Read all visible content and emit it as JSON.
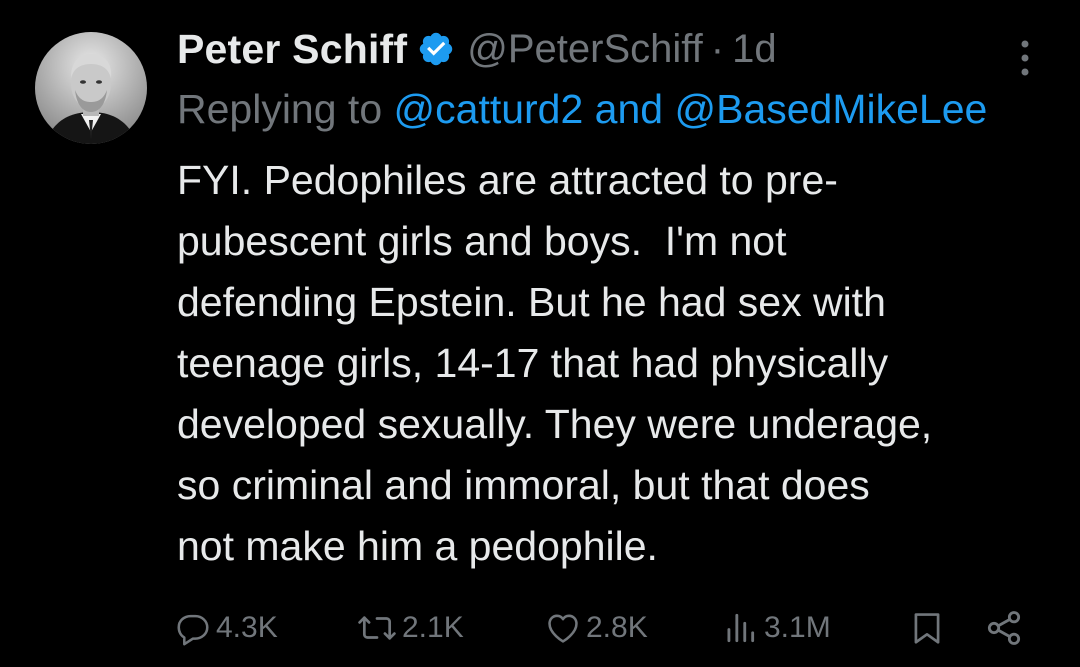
{
  "tweet": {
    "author_name": "Peter Schiff",
    "handle": "@PeterSchiff",
    "separator": "·",
    "time": "1d",
    "replying_prefix": "Replying to ",
    "reply_mention_1": "@catturd2",
    "reply_and": " and ",
    "reply_mention_2": "@BasedMikeLee",
    "text": "FYI. Pedophiles are attracted to pre-\npubescent girls and boys.  I'm not\ndefending Epstein. But he had sex with\nteenage girls, 14-17 that had physically\ndeveloped sexually. They were underage,\nso criminal and immoral, but that does\nnot make him a pedophile."
  },
  "actions": {
    "replies": "4.3K",
    "reposts": "2.1K",
    "likes": "2.8K",
    "views": "3.1M"
  },
  "icons": {
    "verified": "verified-badge-icon",
    "more": "more-vertical-icon",
    "reply": "reply-icon",
    "repost": "repost-icon",
    "like": "heart-icon",
    "views": "views-icon",
    "bookmark": "bookmark-icon",
    "share": "share-icon"
  },
  "colors": {
    "background": "#000000",
    "text": "#e7e9ea",
    "secondary": "#71767b",
    "accent": "#1d9bf0"
  }
}
